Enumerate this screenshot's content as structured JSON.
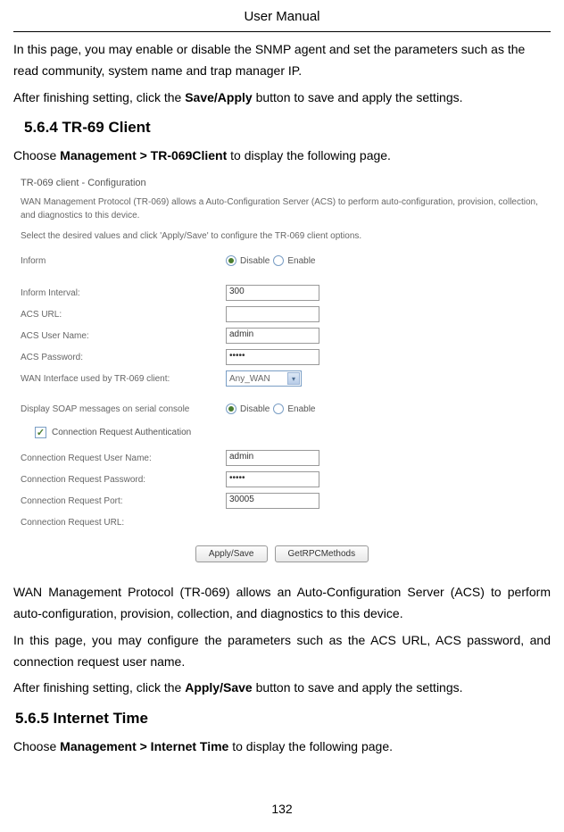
{
  "header": "User Manual",
  "intro_para1": "In this page, you may enable or disable the SNMP agent and set the parameters such as the read community, system name and trap manager IP.",
  "intro_para2_prefix": "After finishing setting, click the ",
  "intro_para2_bold": "Save/Apply",
  "intro_para2_suffix": " button to save and apply the settings.",
  "section_564": "5.6.4   TR-69 Client",
  "section_564_choose_prefix": "Choose ",
  "section_564_choose_bold": "Management > TR-069Client",
  "section_564_choose_suffix": " to display the following page.",
  "config": {
    "title": "TR-069 client - Configuration",
    "desc1": "WAN Management Protocol (TR-069) allows a Auto-Configuration Server (ACS) to perform auto-configuration, provision, collection, and diagnostics to this device.",
    "desc2": "Select the desired values and click 'Apply/Save' to configure the TR-069 client options.",
    "inform_label": "Inform",
    "radio_disable": "Disable",
    "radio_enable": "Enable",
    "inform_interval_label": "Inform Interval:",
    "inform_interval_value": "300",
    "acs_url_label": "ACS URL:",
    "acs_url_value": "",
    "acs_user_label": "ACS User Name:",
    "acs_user_value": "admin",
    "acs_pass_label": "ACS Password:",
    "acs_pass_value": "•••••",
    "wan_if_label": "WAN Interface used by TR-069 client:",
    "wan_if_value": "Any_WAN",
    "soap_label": "Display SOAP messages on serial console",
    "conn_auth_label": "Connection Request Authentication",
    "conn_user_label": "Connection Request User Name:",
    "conn_user_value": "admin",
    "conn_pass_label": "Connection Request Password:",
    "conn_pass_value": "•••••",
    "conn_port_label": "Connection Request Port:",
    "conn_port_value": "30005",
    "conn_url_label": "Connection Request URL:",
    "btn_apply": "Apply/Save",
    "btn_rpc": "GetRPCMethods"
  },
  "para_wan": "WAN Management Protocol (TR-069) allows an Auto-Configuration Server (ACS) to perform auto-configuration, provision, collection, and diagnostics to this device.",
  "para_config": "In this page, you may configure the parameters such as the ACS URL, ACS password, and connection request user name.",
  "para_after_prefix": "After finishing setting, click the ",
  "para_after_bold": "Apply/Save",
  "para_after_suffix": " button to save and apply the settings.",
  "section_565": "5.6.5  Internet Time",
  "section_565_choose_prefix": "Choose ",
  "section_565_choose_bold": "Management > Internet Time",
  "section_565_choose_suffix": " to display the following page.",
  "page_number": "132"
}
